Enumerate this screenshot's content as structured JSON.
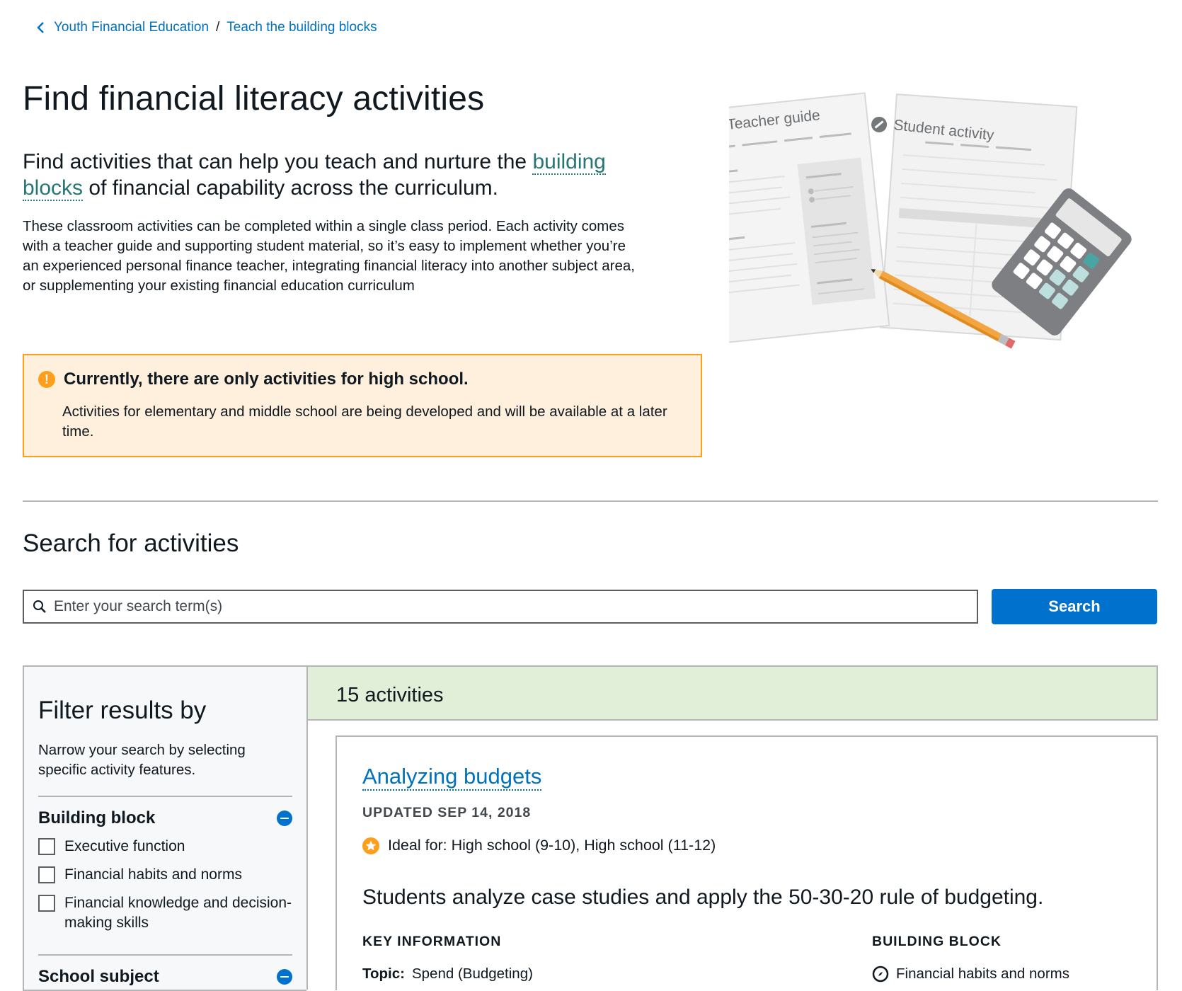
{
  "breadcrumb": {
    "parent": "Youth Financial Education",
    "separator": "/",
    "current": "Teach the building blocks"
  },
  "page": {
    "title": "Find financial literacy activities",
    "lead_before": "Find activities that can help you teach and nurture the ",
    "lead_link": "building blocks",
    "lead_after": " of financial capability across the curriculum.",
    "body": "These classroom activities can be completed within a single class period. Each activity comes with a teacher guide and supporting student material, so it’s easy to implement whether you’re an experienced personal finance teacher, integrating financial literacy into another subject area, or supplementing your existing financial education curriculum"
  },
  "illustration": {
    "teacher_label": "Teacher guide",
    "student_label": "Student activity"
  },
  "notice": {
    "title": "Currently, there are only activities for high school.",
    "body": "Activities for elementary and middle school are being developed and will be available at a later time."
  },
  "search": {
    "heading": "Search for activities",
    "placeholder": "Enter your search term(s)",
    "value": "",
    "button": "Search"
  },
  "filters": {
    "heading": "Filter results by",
    "intro": "Narrow your search by selecting specific activity features.",
    "groups": [
      {
        "label": "Building block",
        "options": [
          "Executive function",
          "Financial habits and norms",
          "Financial knowledge and decision-making skills"
        ]
      },
      {
        "label": "School subject"
      }
    ]
  },
  "results": {
    "count_label": "15 activities"
  },
  "activity": {
    "title": "Analyzing budgets",
    "updated": "UPDATED SEP 14, 2018",
    "ideal_for": "Ideal for: High school (9-10), High school (11-12)",
    "description": "Students analyze case studies and apply the 50-30-20 rule of budgeting.",
    "key_info_label": "KEY INFORMATION",
    "topic_label": "Topic:",
    "topic_value": "Spend (Budgeting)",
    "building_block_label": "BUILDING BLOCK",
    "building_block_value": "Financial habits and norms"
  },
  "colors": {
    "link": "#0071bc",
    "teal_link": "#257675",
    "primary_button": "#0072ce",
    "notice_bg": "#fff0dd",
    "notice_border": "#ff9e1b",
    "results_bar_bg": "#e2efd8",
    "filters_bg": "#f7f8f9"
  }
}
